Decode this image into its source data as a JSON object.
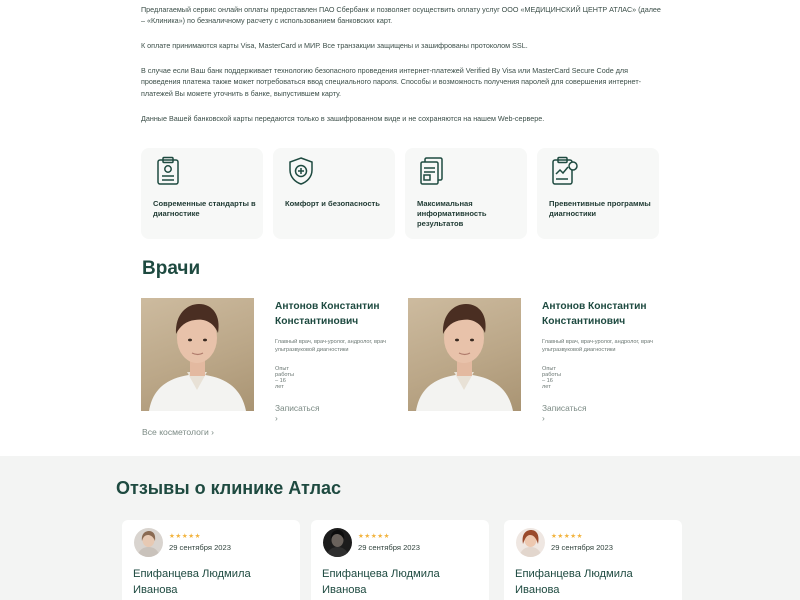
{
  "intro": {
    "p1": "Предлагаемый сервис онлайн оплаты предоставлен ПАО Сбербанк и позволяет осуществить оплату услуг ООО «МЕДИЦИНСКИЙ ЦЕНТР АТЛАС» (далее – «Клиника») по безналичному расчету с использованием банковских карт.",
    "p2": "К оплате принимаются карты Visa, MasterCard и МИР. Все транзакции защищены и зашифрованы протоколом SSL.",
    "p3": "В случае если Ваш банк поддерживает технологию безопасного проведения интернет-платежей Verified By Visa или MasterCard Secure Code для проведения платежа также может потребоваться ввод специального пароля. Способы и возможность получения паролей для совершения интернет-платежей Вы можете уточнить в банке, выпустившем карту.",
    "p4": "Данные Вашей банковской карты передаются только в зашифрованном виде и не сохраняются на нашем Web-сервере."
  },
  "features": [
    {
      "icon": "clipboard-icon",
      "title": "Современные стандарты в диагностике"
    },
    {
      "icon": "shield-icon",
      "title": "Комфорт и безопасность"
    },
    {
      "icon": "document-stack-icon",
      "title": "Максимальная информативность результатов"
    },
    {
      "icon": "clipboard-chart-icon",
      "title": "Превентивные программы диагностики"
    }
  ],
  "doctors": {
    "title": "Врачи",
    "items": [
      {
        "name": "Антонов Константин Константинович",
        "position": "Главный врач, врач-уролог, андролог, врач ультразвуковой диагностики",
        "experience": "Опыт работы – 16 лет",
        "book_label": "Записаться ›"
      },
      {
        "name": "Антонов Константин Константинович",
        "position": "Главный врач, врач-уролог, андролог, врач ультразвуковой диагностики",
        "experience": "Опыт работы – 16 лет",
        "book_label": "Записаться ›"
      }
    ],
    "all_label": "Все косметологи ›"
  },
  "reviews": {
    "title": "Отзывы о клинике Атлас",
    "items": [
      {
        "stars": "★★★★★",
        "date": "29 сентября 2023",
        "name": "Епифанцева Людмила Иванова"
      },
      {
        "stars": "★★★★★",
        "date": "29 сентября 2023",
        "name": "Епифанцева Людмила Иванова"
      },
      {
        "stars": "★★★★★",
        "date": "29 сентября 2023",
        "name": "Епифанцева Людмила Иванова"
      }
    ]
  },
  "colors": {
    "accent": "#1e4a40",
    "text": "#3c4f49",
    "muted": "#7b8a84",
    "star": "#f2b33d",
    "card_bg": "#f7f8f7",
    "section_bg": "#f3f4f3"
  }
}
